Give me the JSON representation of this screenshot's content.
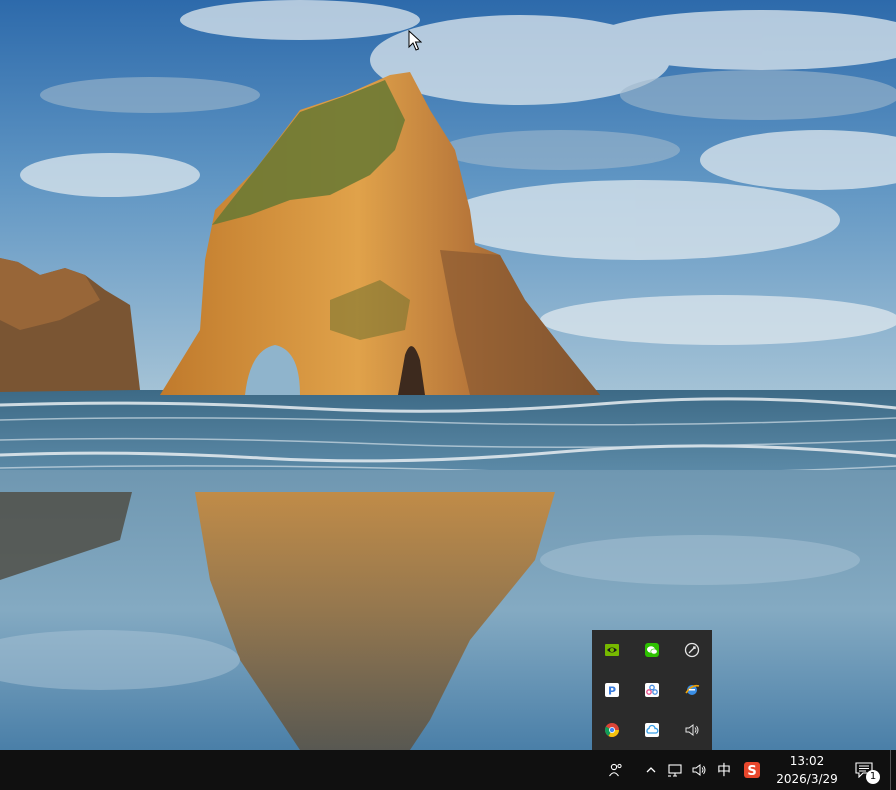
{
  "colors": {
    "sky_top": "#2f6fb0",
    "sky_bottom": "#8fb8d4",
    "rock_lit": "#d9963a",
    "rock_shadow": "#6b4a2a",
    "moss": "#6f7a35",
    "sea": "#4b7894",
    "sand": "#7ba3bd",
    "taskbar": "#101010",
    "tray_popup": "#2b2b2b"
  },
  "tray_popup": {
    "icons": [
      {
        "name": "nvidia-icon",
        "color": "#76b900"
      },
      {
        "name": "wechat-icon",
        "color": "#2dc100"
      },
      {
        "name": "rocket-tray-icon",
        "color": "#e6e6e6"
      },
      {
        "name": "p-app-icon",
        "color": "#3b7ddd"
      },
      {
        "name": "cluster-app-icon",
        "color": "#4a90e2"
      },
      {
        "name": "ie-browser-icon",
        "color": "#f0a30a"
      },
      {
        "name": "chrome-icon",
        "color": "#db4437"
      },
      {
        "name": "cloud-sync-icon",
        "color": "#3aa0e8"
      },
      {
        "name": "volume-icon",
        "color": "#e6e6e6"
      }
    ]
  },
  "taskbar": {
    "people_icon": "people-icon",
    "chevron_icon": "chevron-up-icon",
    "network_icon": "network-icon",
    "volume_icon": "volume-icon",
    "ime_label": "中",
    "sogou_label": "S",
    "clock_time": "13:02",
    "clock_date": "2026/3/29",
    "notification_count": "1"
  }
}
